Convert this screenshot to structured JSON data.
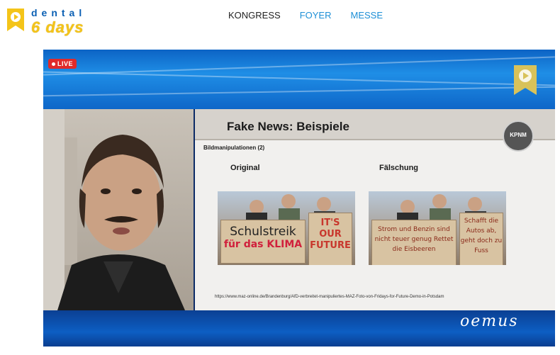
{
  "header": {
    "logo_line1": "dental",
    "logo_line2": "6 days",
    "nav": [
      {
        "label": "KONGRESS"
      },
      {
        "label": "FOYER"
      },
      {
        "label": "MESSE"
      }
    ]
  },
  "video": {
    "live_label": "LIVE",
    "watermark": "oemus",
    "slide": {
      "title": "Fake News: Beispiele",
      "subtitle": "Bildmanipulationen (2)",
      "label_original": "Original",
      "label_fake": "Fälschung",
      "logo_text": "KPNM",
      "original_signs": [
        "Schulstreik",
        "für das KLIMA",
        "IT'S OUR FUTURE"
      ],
      "fake_signs": [
        "Strom und Benzin sind nicht teuer genug Rettet die Eisbeeren",
        "Schafft die Autos ab, geht doch zu Fuss"
      ],
      "source_url": "https://www.maz-online.de/Brandenburg/AfD-verbreitet-manipuliertes-MAZ-Foto-von-Fridays-for-Future-Demo-in-Potsdam"
    }
  },
  "colors": {
    "nav_active": "#222222",
    "nav_link": "#1d8fd6",
    "live_red": "#e02a2a",
    "brand_yellow": "#f4c419",
    "frame_blue": "#0e66c8"
  }
}
